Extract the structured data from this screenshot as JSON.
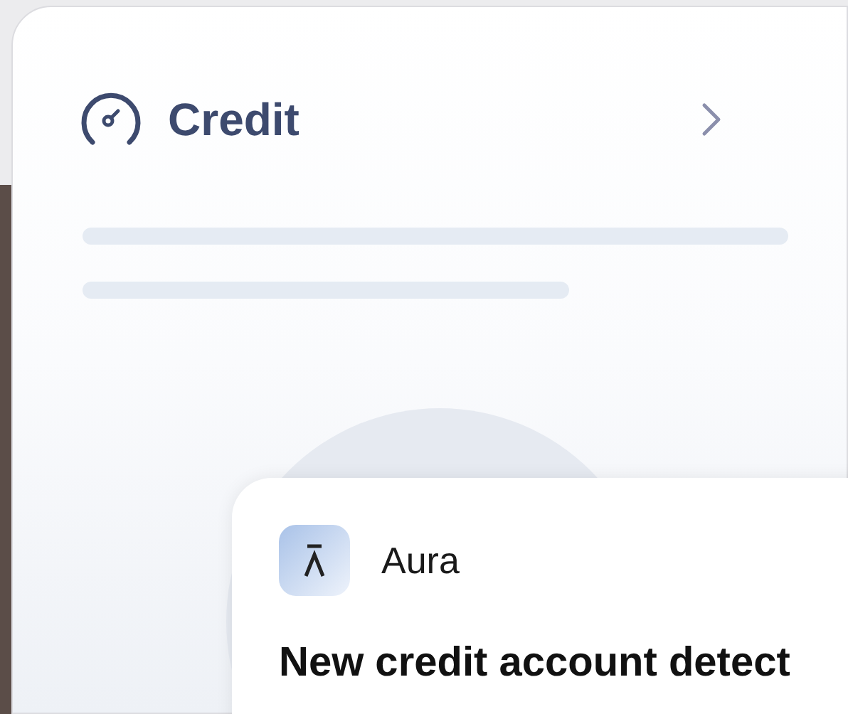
{
  "credit_card": {
    "title": "Credit"
  },
  "notification": {
    "app_name": "Aura",
    "message": "New credit account detect"
  }
}
